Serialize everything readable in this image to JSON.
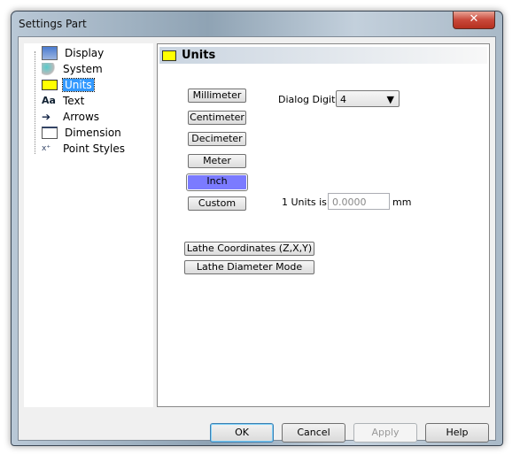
{
  "window": {
    "title": "Settings Part",
    "close_icon": "close-icon"
  },
  "tree": {
    "items": [
      {
        "label": "Display",
        "icon": "display-icon"
      },
      {
        "label": "System",
        "icon": "system-icon"
      },
      {
        "label": "Units",
        "icon": "ruler-icon",
        "selected": true
      },
      {
        "label": "Text",
        "icon": "text-aa-icon"
      },
      {
        "label": "Arrows",
        "icon": "arrow-icon"
      },
      {
        "label": "Dimension",
        "icon": "dimension-icon"
      },
      {
        "label": "Point Styles",
        "icon": "point-styles-icon"
      }
    ]
  },
  "panel": {
    "title": "Units",
    "unit_buttons": [
      "Millimeter",
      "Centimeter",
      "Decimeter",
      "Meter",
      "Inch",
      "Custom"
    ],
    "selected_unit": "Inch",
    "selected_color": "#7b7bff",
    "dialog_digits_label": "Dialog Digits",
    "dialog_digits_value": "4",
    "units_is_label": "1 Units is",
    "units_is_value": "0.0000",
    "units_is_suffix": "mm",
    "lathe_coordinates": "Lathe Coordinates (Z,X,Y)",
    "lathe_diameter": "Lathe Diameter Mode"
  },
  "footer": {
    "ok": "OK",
    "cancel": "Cancel",
    "apply": "Apply",
    "help": "Help"
  }
}
